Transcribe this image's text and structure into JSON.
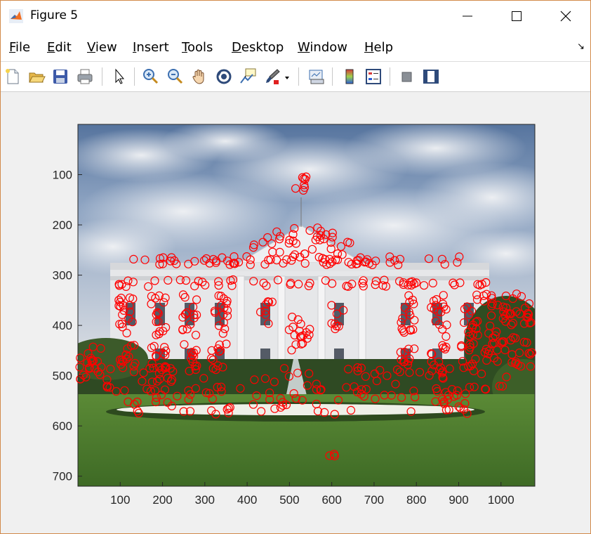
{
  "window": {
    "title": "Figure 5",
    "minimize_icon": "minimize-icon",
    "maximize_icon": "maximize-icon",
    "close_icon": "close-icon"
  },
  "menu": {
    "items": [
      {
        "first": "F",
        "rest": "ile"
      },
      {
        "first": "E",
        "rest": "dit"
      },
      {
        "first": "V",
        "rest": "iew"
      },
      {
        "first": "I",
        "rest": "nsert"
      },
      {
        "first": "T",
        "rest": "ools"
      },
      {
        "first": "D",
        "rest": "esktop"
      },
      {
        "first": "W",
        "rest": "indow"
      },
      {
        "first": "H",
        "rest": "elp"
      }
    ],
    "corner_glyph": "↘"
  },
  "toolbar": {
    "buttons": [
      "new-figure-icon",
      "open-file-icon",
      "save-icon",
      "print-icon",
      "edit-plot-arrow-icon",
      "zoom-in-icon",
      "zoom-out-icon",
      "pan-hand-icon",
      "rotate-3d-icon",
      "data-cursor-icon",
      "brush-icon",
      "brush-dropdown-icon",
      "link-plot-icon",
      "insert-colorbar-icon",
      "insert-legend-icon",
      "hide-plot-tools-icon",
      "show-plot-tools-icon"
    ]
  },
  "plot": {
    "type": "image with feature-point circle overlay",
    "xticks": [
      "100",
      "200",
      "300",
      "400",
      "500",
      "600",
      "700",
      "800",
      "900",
      "1000"
    ],
    "yticks": [
      "100",
      "200",
      "300",
      "400",
      "500",
      "600",
      "700"
    ],
    "xlim": [
      0,
      1080
    ],
    "ylim": [
      0,
      720
    ],
    "marker_color": "#ff0000",
    "marker_shape": "circle"
  }
}
